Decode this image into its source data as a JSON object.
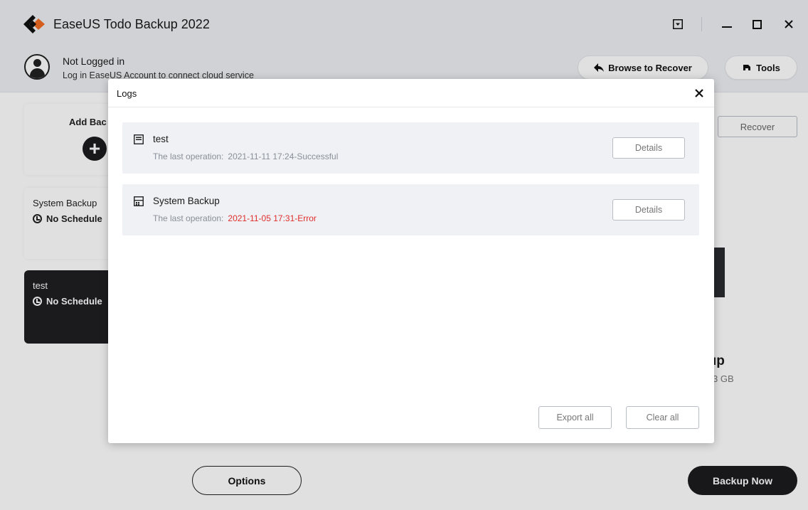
{
  "app": {
    "title": "EaseUS Todo Backup 2022"
  },
  "account": {
    "status": "Not Logged in",
    "hint": "Log in EaseUS Account to connect cloud service"
  },
  "toolbar": {
    "browse_label": "Browse to Recover",
    "tools_label": "Tools"
  },
  "sidebar": {
    "add_label": "Add Bac",
    "cards": [
      {
        "title": "System Backup",
        "schedule": "No Schedule"
      },
      {
        "title": "test",
        "schedule": "No Schedule"
      }
    ]
  },
  "main": {
    "recover_label": "Recover",
    "title_partial": "ıp",
    "size_partial": "3 GB",
    "options_label": "Options",
    "backup_now_label": "Backup Now"
  },
  "dialog": {
    "title": "Logs",
    "items": [
      {
        "name": "test",
        "meta_label": "The last operation:",
        "value": "2021-11-11 17:24-Successful",
        "status": "success",
        "details_label": "Details"
      },
      {
        "name": "System Backup",
        "meta_label": "The last operation:",
        "value": "2021-11-05 17:31-Error",
        "status": "error",
        "details_label": "Details"
      }
    ],
    "export_label": "Export all",
    "clear_label": "Clear all"
  },
  "colors": {
    "accent_orange": "#f26b21",
    "error_red": "#e02d2d",
    "dark": "#1c1c1e"
  },
  "icons": {
    "logo": "easeus-logo-icon",
    "menu": "dropdown-menu-icon",
    "browse": "arrow-left-icon",
    "tools": "wrench-icon",
    "file_backup": "file-backup-icon",
    "system_backup": "system-backup-icon",
    "clock": "clock-icon"
  }
}
